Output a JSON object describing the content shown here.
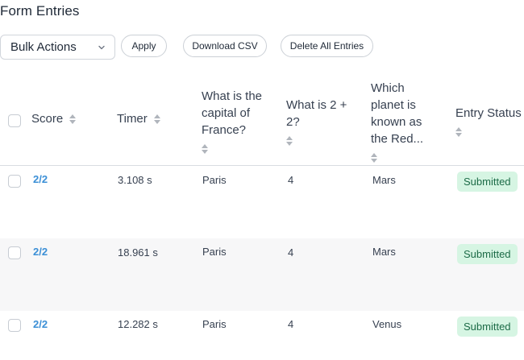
{
  "page": {
    "title": "Form Entries"
  },
  "toolbar": {
    "bulk_actions": "Bulk Actions",
    "apply": "Apply",
    "download_csv": "Download CSV",
    "delete_all": "Delete All Entries"
  },
  "table": {
    "columns": {
      "score": "Score",
      "timer": "Timer",
      "q1": [
        "What is the",
        "capital of",
        "France?"
      ],
      "q2": [
        "What is 2 +",
        "2?"
      ],
      "q3": [
        "Which",
        "planet is",
        "known as",
        "the Red..."
      ],
      "status": "Entry Status"
    },
    "rows": [
      {
        "score": "2/2",
        "timer": "3.108 s",
        "q1": "Paris",
        "q2": "4",
        "q3": "Mars",
        "status": "Submitted"
      },
      {
        "score": "2/2",
        "timer": "18.961 s",
        "q1": "Paris",
        "q2": "4",
        "q3": "Mars",
        "status": "Submitted"
      },
      {
        "score": "2/2",
        "timer": "12.282 s",
        "q1": "Paris",
        "q2": "4",
        "q3": "Venus",
        "status": "Submitted"
      }
    ]
  },
  "colors": {
    "accent": "#3b8fd6",
    "badge_bg": "#d6f5e3",
    "badge_text": "#1c6b47"
  }
}
